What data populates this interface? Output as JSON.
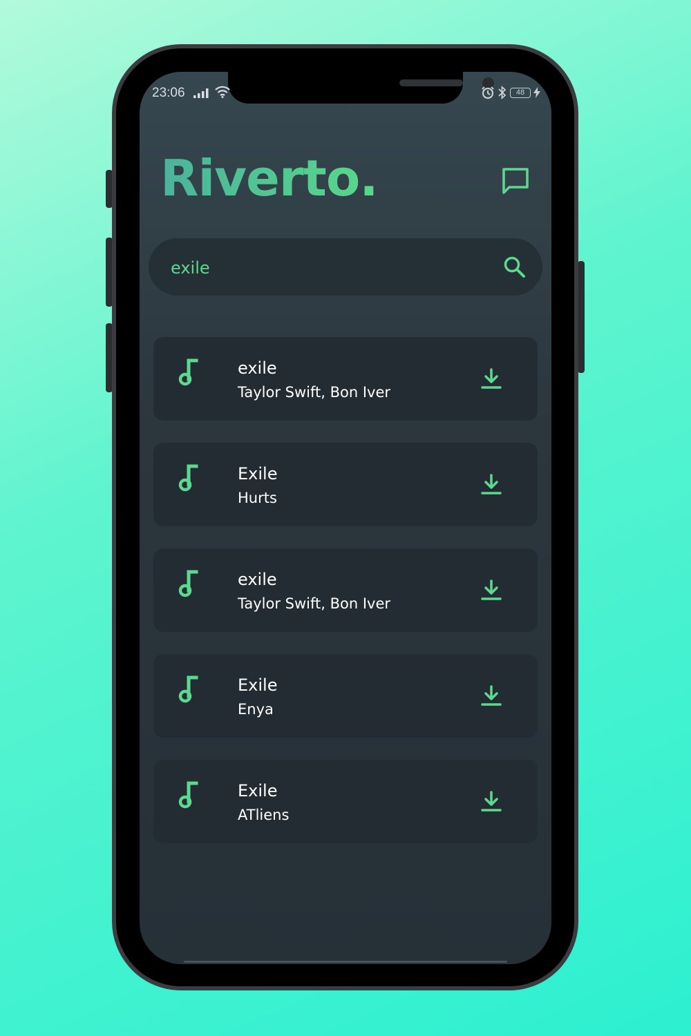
{
  "status_bar": {
    "time": "23:06",
    "battery": "48",
    "icons": [
      "signal-icon",
      "wifi-icon",
      "alarm-icon",
      "bluetooth-icon",
      "battery-icon",
      "charging-icon"
    ]
  },
  "header": {
    "app_name": "Riverto.",
    "chat_icon": "chat-bubble-icon"
  },
  "search": {
    "value": "exile",
    "icon": "search-icon"
  },
  "results": [
    {
      "title": "exile",
      "artist": "Taylor Swift, Bon Iver"
    },
    {
      "title": "Exile",
      "artist": "Hurts"
    },
    {
      "title": "exile",
      "artist": "Taylor Swift, Bon Iver"
    },
    {
      "title": "Exile",
      "artist": "Enya"
    },
    {
      "title": "Exile",
      "artist": "ATliens"
    }
  ],
  "colors": {
    "accent": "#5cd98f",
    "card": "#232c32",
    "background_top": "#36474f",
    "background_bottom": "#263037"
  }
}
